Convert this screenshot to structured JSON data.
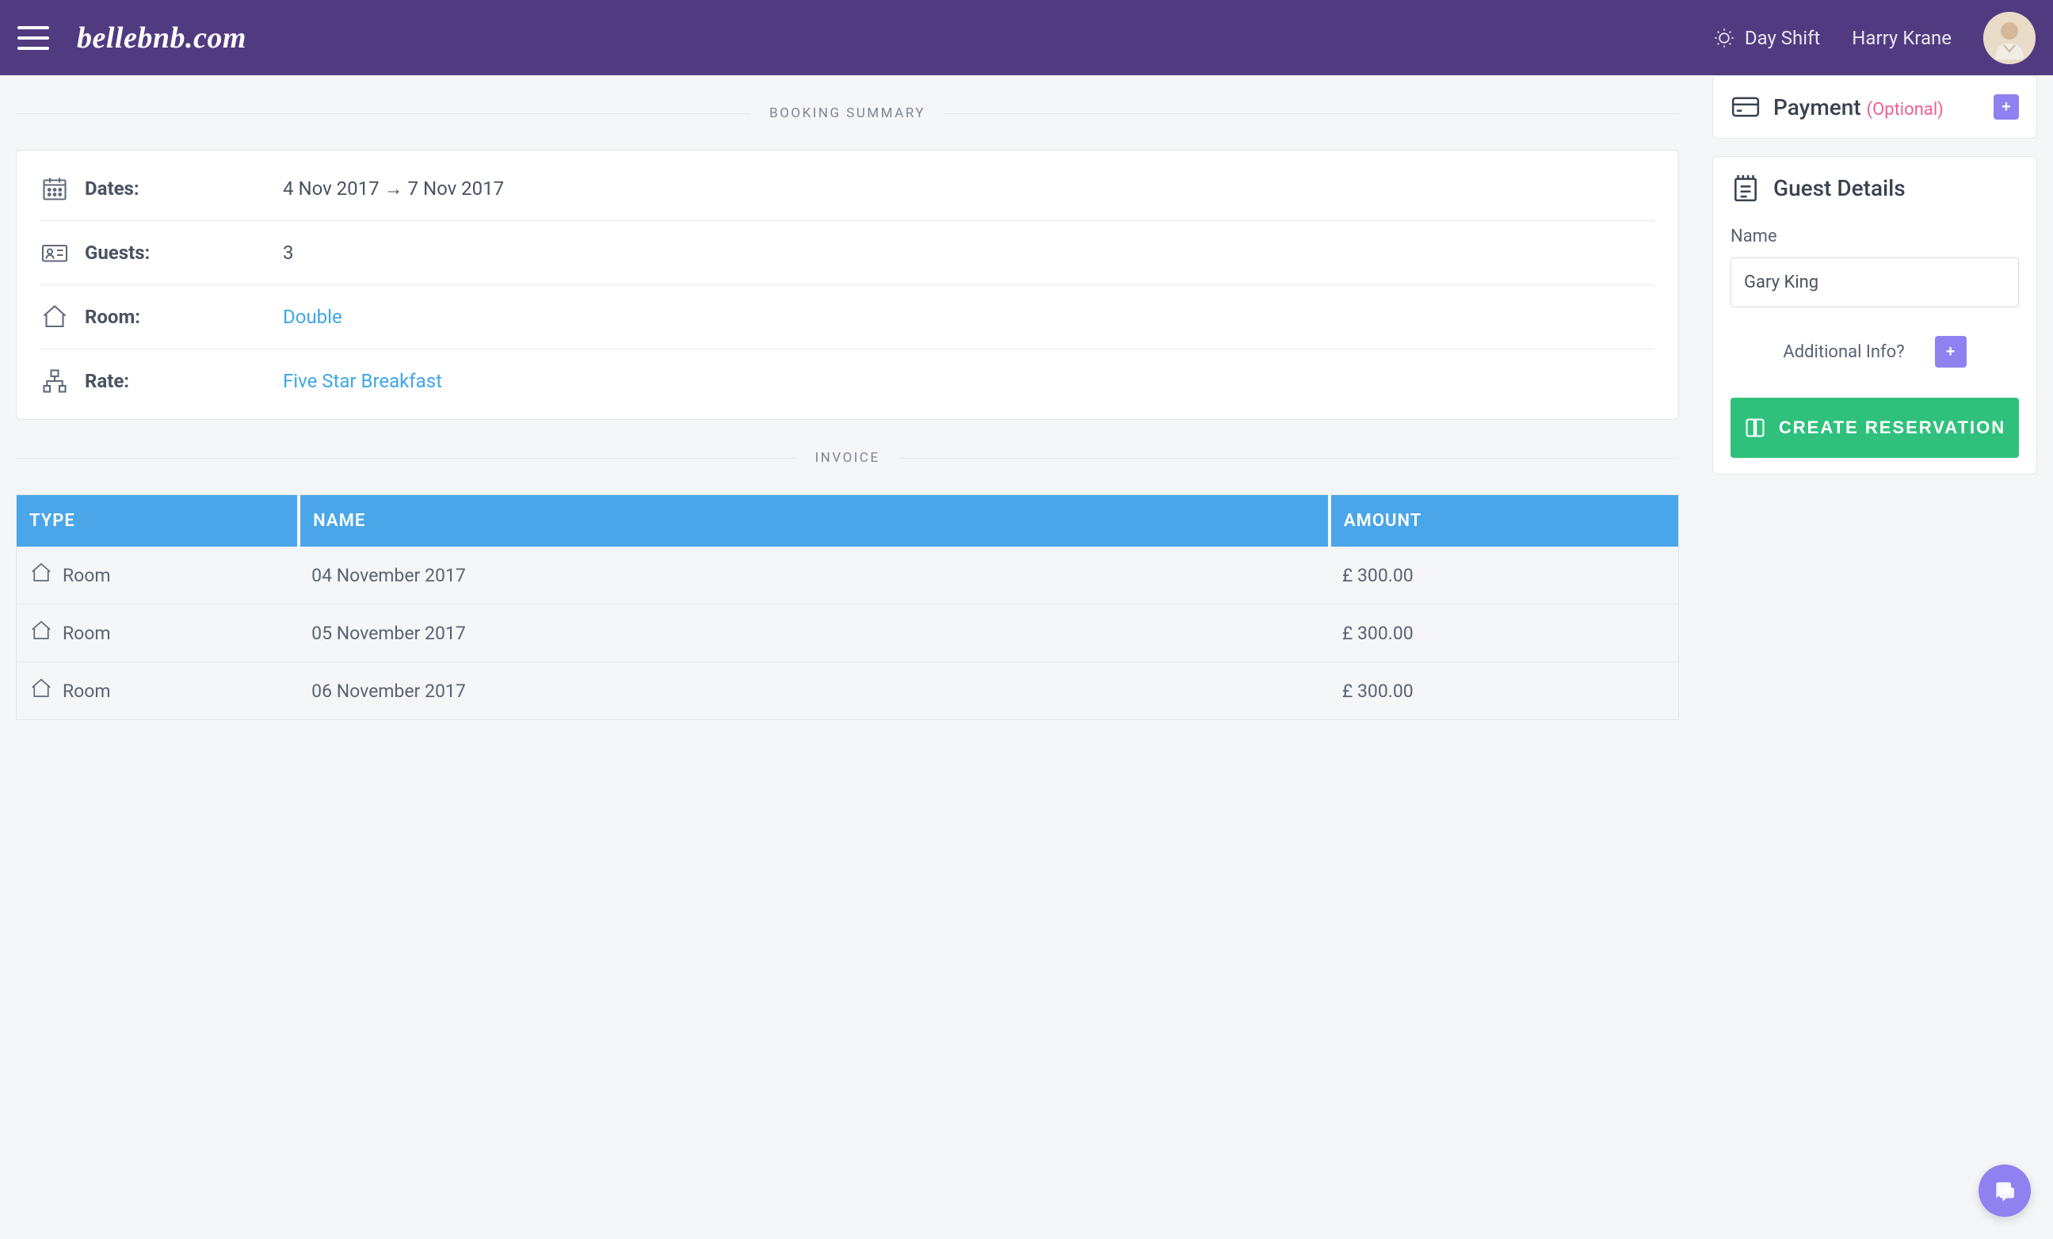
{
  "header": {
    "logo": "bellebnb.com",
    "shift_label": "Day Shift",
    "user_name": "Harry Krane"
  },
  "sections": {
    "summary_title": "BOOKING SUMMARY",
    "invoice_title": "INVOICE"
  },
  "summary": {
    "dates_label": "Dates:",
    "dates_value": "4 Nov 2017 → 7 Nov 2017",
    "guests_label": "Guests:",
    "guests_value": "3",
    "room_label": "Room:",
    "room_value": "Double",
    "rate_label": "Rate:",
    "rate_value": "Five Star Breakfast"
  },
  "invoice": {
    "columns": {
      "type": "TYPE",
      "name": "NAME",
      "amount": "AMOUNT"
    },
    "rows": [
      {
        "type": "Room",
        "name": "04 November 2017",
        "amount": "£ 300.00"
      },
      {
        "type": "Room",
        "name": "05 November 2017",
        "amount": "£ 300.00"
      },
      {
        "type": "Room",
        "name": "06 November 2017",
        "amount": "£ 300.00"
      }
    ]
  },
  "payment": {
    "title": "Payment",
    "optional": "(Optional)"
  },
  "guest_details": {
    "title": "Guest Details",
    "name_label": "Name",
    "name_value": "Gary King",
    "additional_info_label": "Additional Info?",
    "create_button": "CREATE RESERVATION"
  }
}
